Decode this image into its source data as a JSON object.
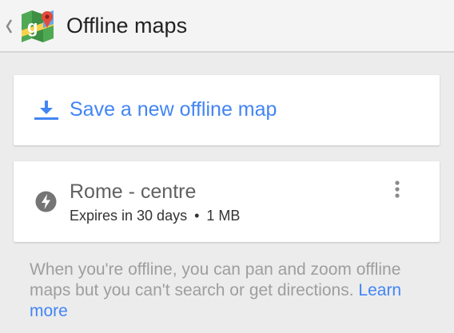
{
  "action_bar": {
    "title": "Offline maps",
    "back_icon": "chevron-left-icon",
    "logo_icon": "google-maps-logo"
  },
  "save_card": {
    "label": "Save a new offline map",
    "icon": "download-icon"
  },
  "saved_maps": [
    {
      "name": "Rome - centre",
      "expiry": "Expires in 30 days",
      "separator": "•",
      "size": "1 MB",
      "icon": "bolt-icon",
      "menu_icon": "overflow-menu-icon"
    }
  ],
  "info": {
    "text": "When you're offline, you can pan and zoom offline maps but you can't search or get directions.",
    "link_label": "Learn more"
  },
  "colors": {
    "accent": "#4285f4",
    "background": "#ececec",
    "card": "#ffffff"
  }
}
